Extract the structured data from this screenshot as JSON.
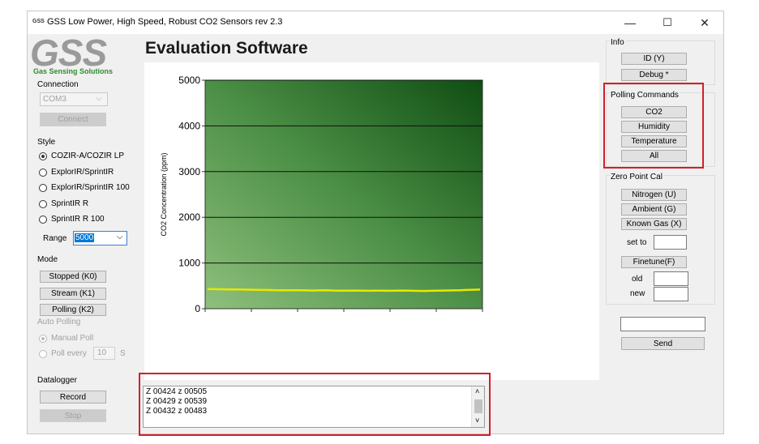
{
  "window": {
    "title_logo": "GSS",
    "title": "GSS Low Power, High Speed, Robust  CO2 Sensors  rev 2.3",
    "controls": {
      "minimize": "—",
      "maximize": "☐",
      "close": "✕"
    }
  },
  "header": {
    "logo_text": "GSS",
    "logo_tagline": "Gas Sensing Solutions",
    "app_title": "Evaluation Software"
  },
  "connection": {
    "label": "Connection",
    "port_value": "COM3",
    "connect_label": "Connect"
  },
  "style": {
    "label": "Style",
    "options": [
      {
        "label": "COZIR-A/COZIR LP",
        "selected": true
      },
      {
        "label": "ExplorIR/SprintIR",
        "selected": false
      },
      {
        "label": "ExplorIR/SprintIR 100",
        "selected": false
      },
      {
        "label": "SprintIR R",
        "selected": false
      },
      {
        "label": "SprintIR R 100",
        "selected": false
      }
    ],
    "range_label": "Range",
    "range_value": "5000"
  },
  "mode": {
    "label": "Mode",
    "stopped_label": "Stopped (K0)",
    "stream_label": "Stream (K1)",
    "polling_label": "Polling (K2)",
    "auto_polling_label": "Auto Polling",
    "manual_poll_label": "Manual Poll",
    "poll_every_label": "Poll every",
    "poll_every_value": "10",
    "poll_unit": "S"
  },
  "datalogger": {
    "label": "Datalogger",
    "record_label": "Record",
    "stop_label": "Stop"
  },
  "info": {
    "label": "Info",
    "id_label": "ID (Y)",
    "debug_label": "Debug *"
  },
  "polling_commands": {
    "label": "Polling Commands",
    "co2_label": "CO2",
    "humidity_label": "Humidity",
    "temperature_label": "Temperature",
    "all_label": "All"
  },
  "zero_point": {
    "label": "Zero Point Cal",
    "nitrogen_label": "Nitrogen (U)",
    "ambient_label": "Ambient (G)",
    "known_gas_label": "Known Gas (X)",
    "set_to_label": "set to",
    "finetune_label": "Finetune(F)",
    "old_label": "old",
    "new_label": "new"
  },
  "send": {
    "command_value": "",
    "send_label": "Send"
  },
  "log": {
    "lines": [
      "Z 00424 z 00505",
      "Z 00429 z 00539",
      "Z 00432 z 00483"
    ]
  },
  "chart_data": {
    "type": "line",
    "ylabel": "CO2 Concentration (ppm)",
    "ylim": [
      0,
      5000
    ],
    "yticks": [
      "0",
      "1000",
      "2000",
      "3000",
      "4000",
      "5000"
    ],
    "grid": true,
    "series": [
      {
        "color": "#e8e800",
        "values": [
          430,
          428,
          425,
          422,
          420,
          418,
          415,
          413,
          410,
          408,
          405,
          403,
          402,
          404,
          400,
          398,
          400,
          402,
          398,
          395,
          396,
          398,
          394,
          392,
          395,
          393,
          392,
          396,
          398,
          394,
          390,
          388,
          392,
          395,
          398,
          400,
          405,
          410,
          415,
          418
        ]
      }
    ]
  }
}
